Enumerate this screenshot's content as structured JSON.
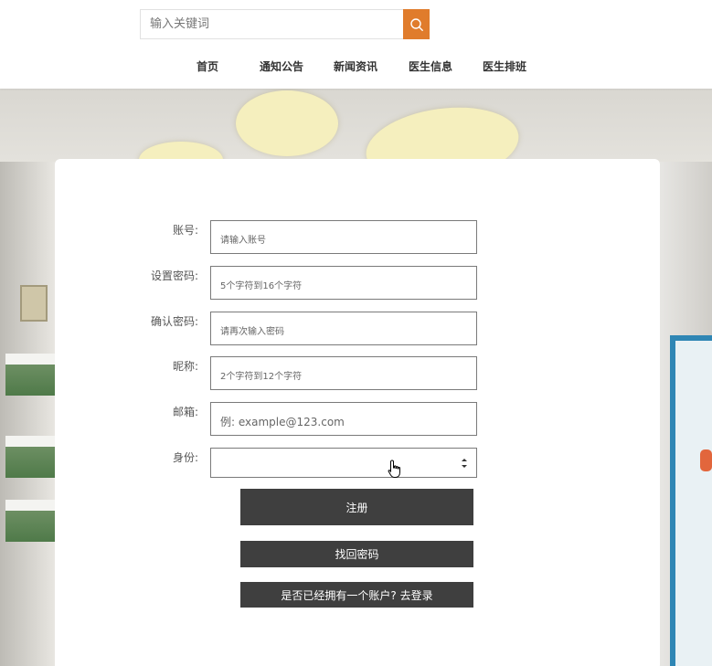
{
  "search": {
    "placeholder": "输入关键词",
    "icon": "search-icon"
  },
  "nav": {
    "items": [
      {
        "label": "首页"
      },
      {
        "label": "通知公告"
      },
      {
        "label": "新闻资讯"
      },
      {
        "label": "医生信息"
      },
      {
        "label": "医生排班"
      }
    ]
  },
  "form": {
    "account": {
      "label": "账号:",
      "placeholder": "请输入账号"
    },
    "password": {
      "label": "设置密码:",
      "placeholder": "5个字符到16个字符"
    },
    "confirm": {
      "label": "确认密码:",
      "placeholder": "请再次输入密码"
    },
    "nickname": {
      "label": "昵称:",
      "placeholder": "2个字符到12个字符"
    },
    "email": {
      "label": "邮箱:",
      "placeholder": "例: example@123.com"
    },
    "identity": {
      "label": "身份:",
      "value": ""
    }
  },
  "buttons": {
    "register": "注册",
    "find_password": "找回密码",
    "login_prompt": "是否已经拥有一个账户? 去登录"
  },
  "colors": {
    "search_button": "#e07c2c",
    "button_bg": "#3f3f3f",
    "button_text": "#ffffff",
    "lamp": "#f5efbe",
    "door_frame": "#2f86b4"
  }
}
